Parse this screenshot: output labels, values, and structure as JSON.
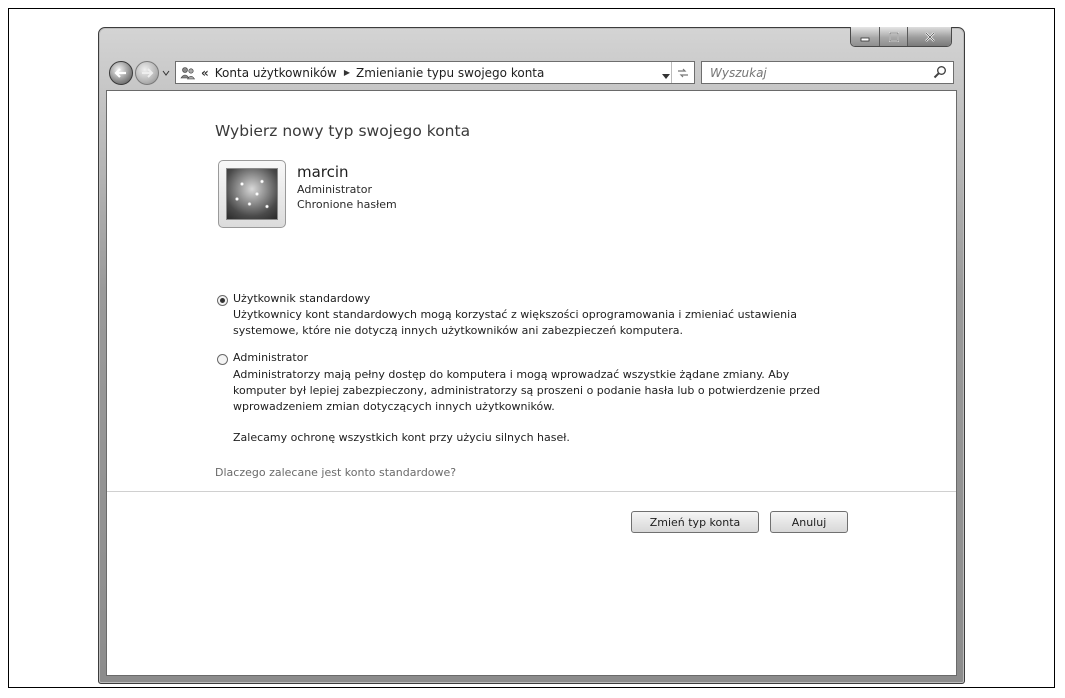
{
  "navigation": {
    "breadcrumb_overflow": "«",
    "breadcrumbs": [
      "Konta użytkowników",
      "Zmienianie typu swojego konta"
    ],
    "search_placeholder": "Wyszukaj"
  },
  "page": {
    "heading": "Wybierz nowy typ swojego konta",
    "user": {
      "name": "marcin",
      "role": "Administrator",
      "password_status": "Chronione hasłem"
    },
    "options": {
      "selected": "standard",
      "standard": {
        "label": "Użytkownik standardowy",
        "description_lines": [
          "Użytkownicy kont standardowych mogą korzystać z większości oprogramowania i zmieniać ustawienia",
          "systemowe, które nie dotyczą innych użytkowników ani zabezpieczeń komputera."
        ]
      },
      "admin": {
        "label": "Administrator",
        "description_lines": [
          "Administratorzy mają pełny dostęp do komputera i mogą wprowadzać wszystkie żądane zmiany. Aby",
          "komputer był lepiej zabezpieczony, administratorzy są proszeni o podanie hasła lub o potwierdzenie przed",
          "wprowadzeniem zmian dotyczących innych użytkowników."
        ]
      }
    },
    "recommendation": "Zalecamy ochronę wszystkich kont przy użyciu silnych haseł.",
    "why_link": "Dlaczego zalecane jest konto standardowe?"
  },
  "buttons": {
    "change": "Zmień typ konta",
    "cancel": "Anuluj"
  },
  "icons": {
    "back": "back-arrow-icon",
    "forward": "forward-arrow-icon",
    "control_panel": "users-icon",
    "search": "search-icon",
    "refresh": "refresh-icon",
    "minimize": "minimize-icon",
    "maximize": "maximize-icon",
    "close": "close-icon"
  }
}
